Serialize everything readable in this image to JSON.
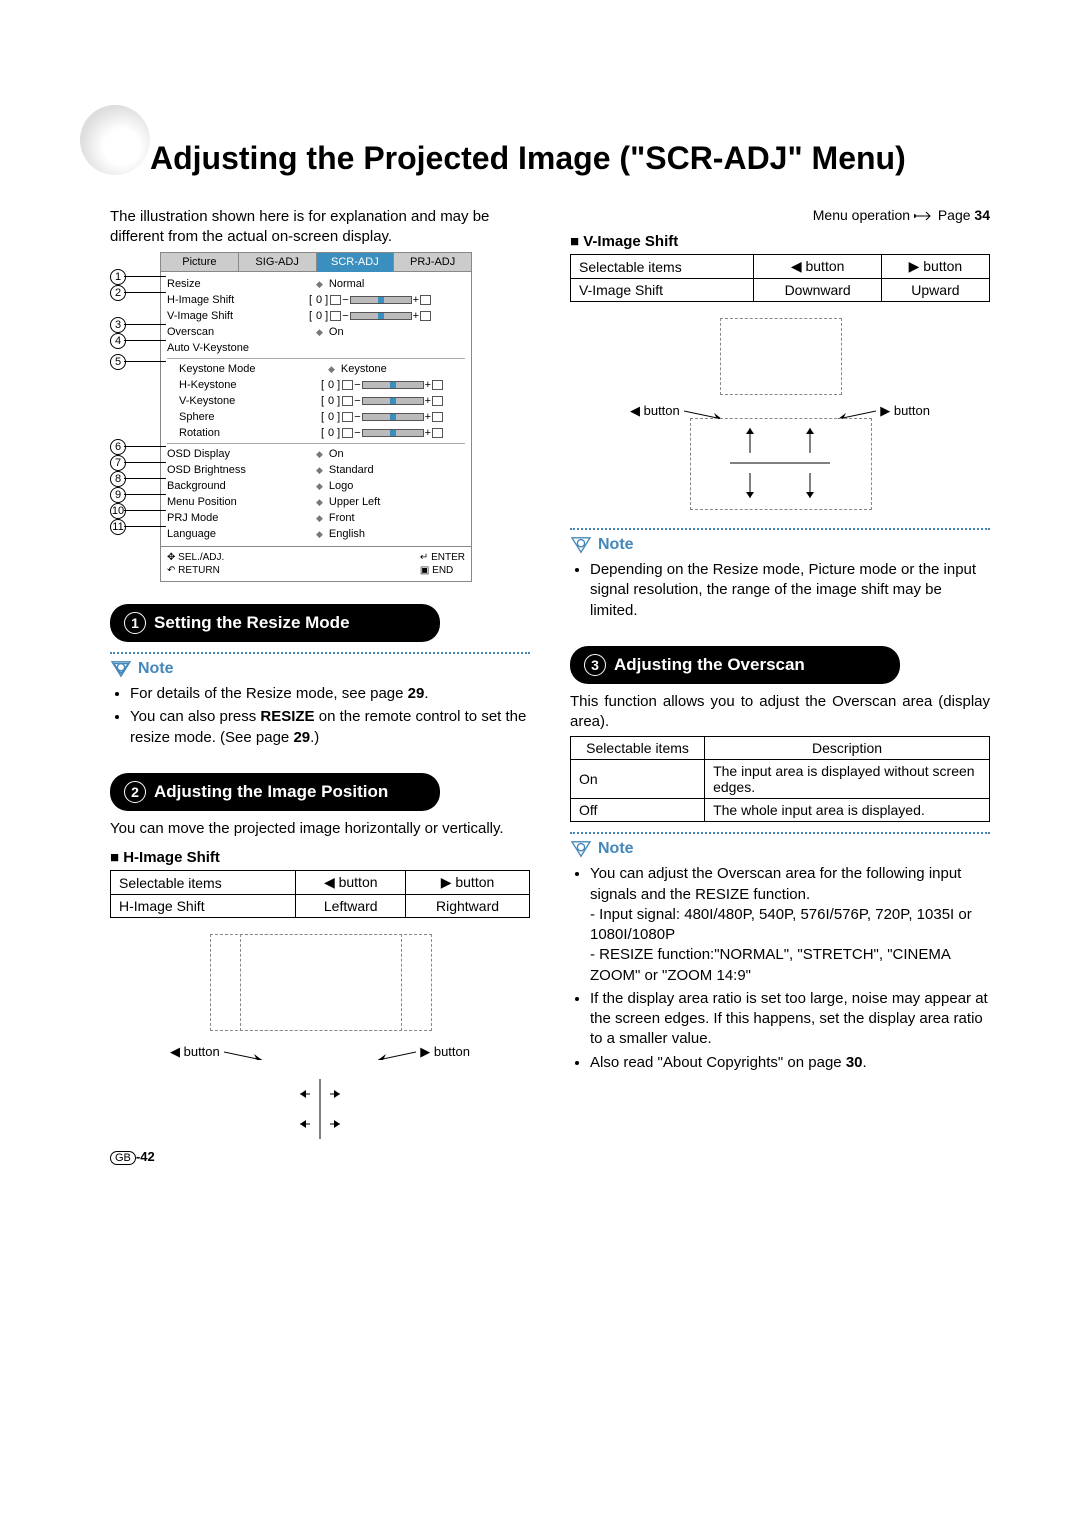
{
  "page": {
    "title": "Adjusting the Projected Image (\"SCR-ADJ\" Menu)",
    "menu_op": "Menu operation ",
    "menu_op_page_label": "Page ",
    "menu_op_page": "34",
    "intro": "The illustration shown here is for explanation and may be different from the actual on-screen display.",
    "number_region": "GB",
    "number": "-42"
  },
  "osd": {
    "tabs": [
      "Picture",
      "SIG-ADJ",
      "SCR-ADJ",
      "PRJ-ADJ"
    ],
    "active_tab": "SCR-ADJ",
    "rows": [
      {
        "n": 1,
        "label": "Resize",
        "type": "opt",
        "val": "Normal"
      },
      {
        "n": 2,
        "label": "H-Image Shift",
        "type": "slider",
        "mid": "[",
        "val": "0"
      },
      {
        "n": 2,
        "label": "V-Image Shift",
        "type": "slider",
        "mid": "[",
        "val": "0",
        "join": true
      },
      {
        "n": 3,
        "label": "Overscan",
        "type": "opt",
        "val": "On"
      },
      {
        "n": 4,
        "label": "Auto V-Keystone",
        "type": "none"
      },
      {
        "sep": true
      },
      {
        "n": 5,
        "label": "Keystone Mode",
        "type": "opt",
        "val": "Keystone",
        "indent": true
      },
      {
        "n": 5,
        "label": "H-Keystone",
        "type": "slider",
        "mid": "[",
        "val": "0",
        "indent": true,
        "join": true
      },
      {
        "n": 5,
        "label": "V-Keystone",
        "type": "slider",
        "mid": "[",
        "val": "0",
        "indent": true,
        "join": true
      },
      {
        "n": 5,
        "label": "Sphere",
        "type": "slider",
        "mid": "[",
        "val": "0",
        "indent": true,
        "join": true
      },
      {
        "n": 5,
        "label": "Rotation",
        "type": "slider",
        "mid": "[",
        "val": "0",
        "indent": true,
        "join": true
      },
      {
        "sep": true
      },
      {
        "n": 6,
        "label": "OSD Display",
        "type": "opt",
        "val": "On"
      },
      {
        "n": 7,
        "label": "OSD Brightness",
        "type": "opt",
        "val": "Standard"
      },
      {
        "n": 8,
        "label": "Background",
        "type": "opt",
        "val": "Logo"
      },
      {
        "n": 9,
        "label": "Menu Position",
        "type": "opt",
        "val": "Upper Left"
      },
      {
        "n": 10,
        "label": "PRJ Mode",
        "type": "opt",
        "val": "Front"
      },
      {
        "n": 11,
        "label": "Language",
        "type": "opt",
        "val": "English"
      }
    ],
    "footer": {
      "sel": "SEL./ADJ.",
      "return": "RETURN",
      "enter": "ENTER",
      "end": "END"
    }
  },
  "sections": {
    "s1": {
      "num": "1",
      "title": "Setting the Resize Mode",
      "note_label": "Note",
      "notes": [
        "For details of the Resize mode, see page 29.",
        "You can also press RESIZE on the remote control to set the resize mode. (See page 29.)"
      ]
    },
    "s2": {
      "num": "2",
      "title": "Adjusting the Image Position",
      "body": "You can move the projected image horizontally or vertically.",
      "h_head": "■ H-Image Shift",
      "v_head": "■ V-Image Shift",
      "table_h": {
        "c1": "Selectable items",
        "c2": "◀ button",
        "c3": "▶ button",
        "r1c1": "H-Image Shift",
        "r1c2": "Leftward",
        "r1c3": "Rightward"
      },
      "table_v": {
        "c1": "Selectable items",
        "c2": "◀ button",
        "c3": "▶ button",
        "r1c1": "V-Image Shift",
        "r1c2": "Downward",
        "r1c3": "Upward"
      },
      "btn_left": "◀ button",
      "btn_right": "▶ button",
      "note_label": "Note",
      "notes": [
        "Depending on the Resize mode, Picture mode or the input signal resolution, the range of the image shift may be limited."
      ]
    },
    "s3": {
      "num": "3",
      "title": "Adjusting the Overscan",
      "body": "This function allows you to adjust the Overscan area (display area).",
      "table": {
        "c1": "Selectable items",
        "c2": "Description",
        "r1c1": "On",
        "r1c2": "The input area is displayed without screen edges.",
        "r2c1": "Off",
        "r2c2": "The whole input area is displayed."
      },
      "note_label": "Note",
      "notes_lead": "You can adjust the Overscan area for the following input signals and the RESIZE function.",
      "notes_sub": [
        "Input signal: 480I/480P, 540P, 576I/576P, 720P, 1035I or 1080I/1080P",
        "RESIZE function:\"NORMAL\", \"STRETCH\", \"CINEMA ZOOM\" or \"ZOOM 14:9\""
      ],
      "note2": "If the display area ratio is set too large, noise may appear at the screen edges. If this happens, set the display area ratio to a smaller value.",
      "note3": "Also read \"About Copyrights\" on page 30."
    }
  }
}
